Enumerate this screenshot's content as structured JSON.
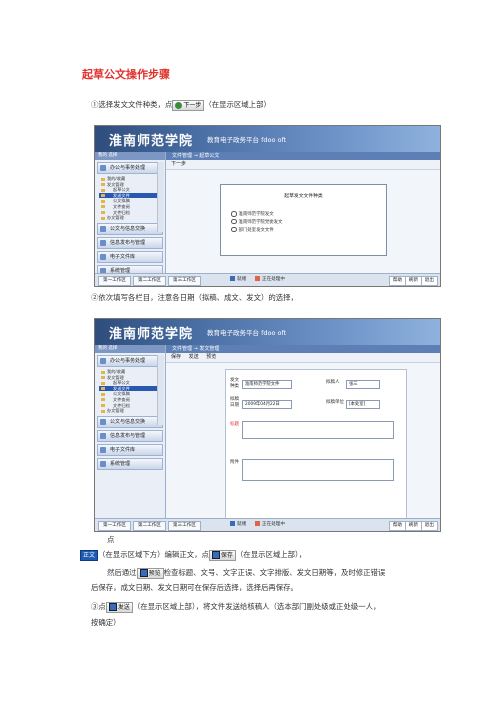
{
  "doc": {
    "title": "起草公文操作步骤",
    "step1_prefix": "①选择发文文件种类，点",
    "step1_suffix": "（在显示区域上部）",
    "step2": "②依次填写各栏目，注意各日期（拟稿、成文、发文）的选择，",
    "point_label": "点",
    "step2_line2_a": "（在显示区域下方）编辑正文，点",
    "step2_line2_b": "（在显示区域上部），",
    "step2_line3": "然后通过",
    "step2_line3_b": "检查标题、文号、文字正误、文字排版、发文日期等，及时修正错误",
    "step2_line4": "后保存，成文日期、发文日期可在保存后选择，选择后再保存。",
    "step3_prefix": "③点",
    "step3_suffix": "（在显示区域上部），将文件发送给核稿人（选本部门副处级或正处级一人，",
    "step3_line2": "按确定）"
  },
  "buttons": {
    "next": "下一步",
    "body_text": "正文",
    "preview": "预览",
    "save": "保存",
    "send": "发送"
  },
  "screenshot1": {
    "school": "淮南师范学院",
    "platform": "教育电子政务平台 fdoo oft",
    "sidebar_header": "我的 选择",
    "groups": [
      "办公与事务处理",
      "公文与信息交换",
      "信息发布与管理",
      "电子文件库",
      "系统管理"
    ],
    "tree": [
      "我的/收藏",
      "发文管理",
      "起草公文",
      "发送文件",
      "公文拟稿",
      "文件查阅",
      "文件归档",
      "办文管理"
    ],
    "crumb": "文件管理 → 起草公文",
    "toolbar": "下一步",
    "dialog_title": "起草发文文件种类",
    "options": [
      "淮南师范学院发文",
      "淮南师范学院党委发文",
      "部门处室发文文件"
    ],
    "tabs": [
      "第一工作区",
      "第二工作区",
      "第三工作区"
    ],
    "status": [
      "就绪",
      "正在处理中"
    ],
    "right_btns": [
      "帮助",
      "刷新",
      "退出"
    ]
  },
  "screenshot2": {
    "school": "淮南师范学院",
    "platform": "教育电子政务平台 fdoo oft",
    "sidebar_header": "我的 选择",
    "groups": [
      "办公与事务处理",
      "公文与信息交换",
      "信息发布与管理",
      "电子文件库",
      "系统管理"
    ],
    "tree": [
      "我的/收藏",
      "发文管理",
      "起草公文",
      "发送文件",
      "公文拟稿",
      "文件查阅",
      "文件归档",
      "办文管理"
    ],
    "crumb": "文件管理 → 发文管理",
    "toolbar": [
      "保存",
      "发送",
      "预览"
    ],
    "fields": {
      "type_label": "发文种类",
      "type_value": "淮南师范学院文件",
      "drafter_label": "拟稿人",
      "drafter_value": "张三",
      "date_label": "拟稿日期",
      "date_value": "2009年04月22日",
      "unit_label": "拟稿单位",
      "unit_value": "[本处室]",
      "title_label": "标题",
      "attach_label": "附件"
    },
    "tabs": [
      "第一工作区",
      "第二工作区",
      "第三工作区"
    ],
    "status": [
      "就绪",
      "正在处理中"
    ],
    "right_btns": [
      "帮助",
      "刷新",
      "退出"
    ],
    "bottom_left": "正文"
  }
}
